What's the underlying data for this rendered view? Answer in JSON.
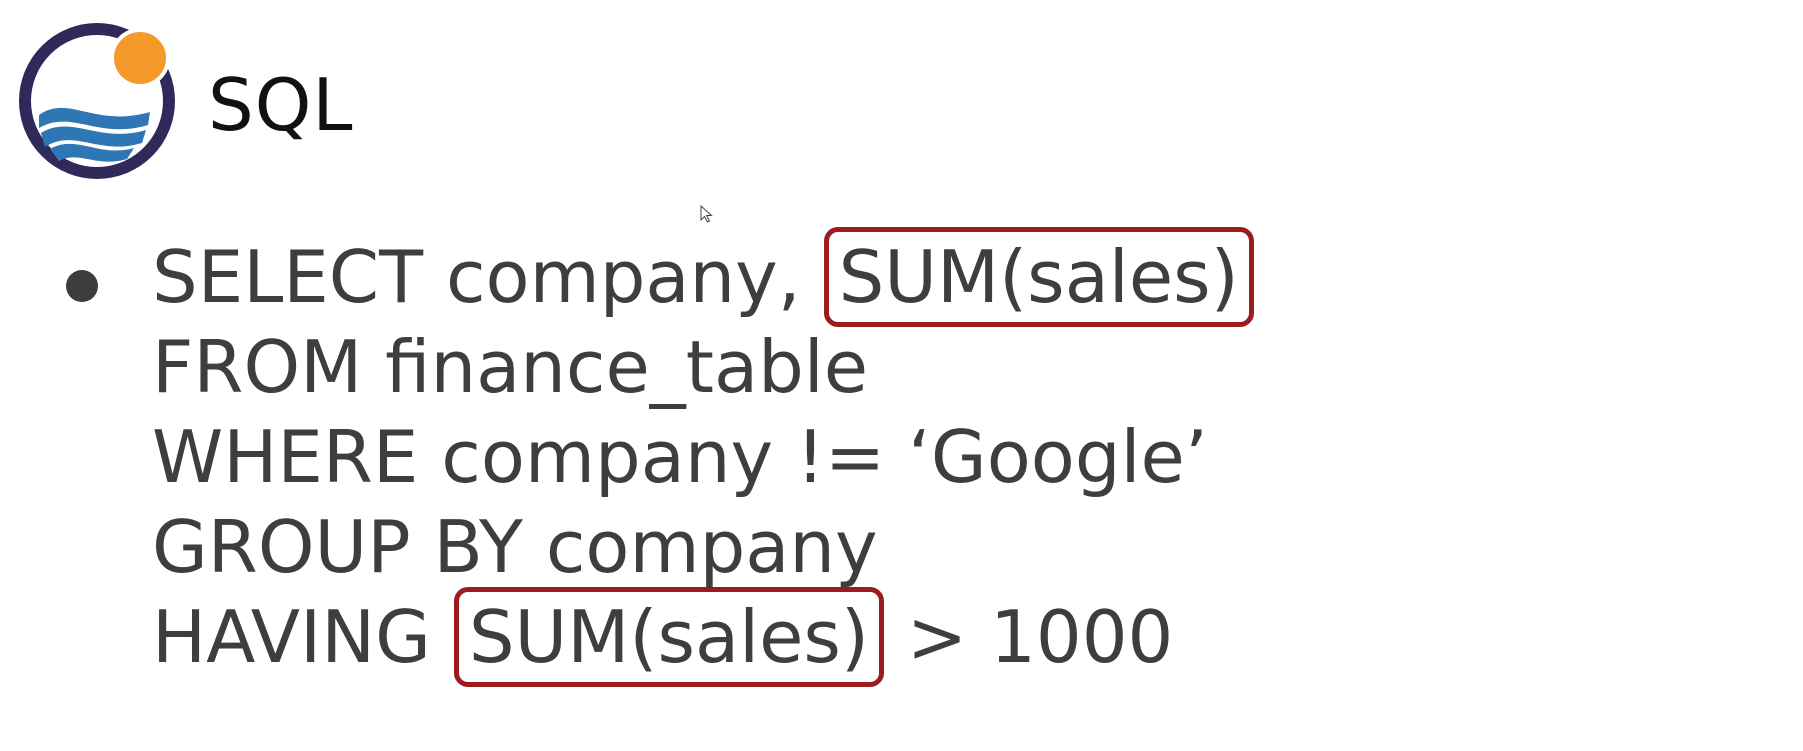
{
  "header": {
    "title": "SQL"
  },
  "code": {
    "lines": [
      {
        "before": "SELECT company, ",
        "highlight": "SUM(sales)",
        "after": ""
      },
      {
        "before": "FROM finance_table",
        "highlight": "",
        "after": ""
      },
      {
        "before": "WHERE company != ‘Google’",
        "highlight": "",
        "after": ""
      },
      {
        "before": "GROUP BY company",
        "highlight": "",
        "after": ""
      },
      {
        "before": "HAVING ",
        "highlight": "SUM(sales)",
        "after": " > 1000"
      }
    ]
  },
  "icons": {
    "logo": "logo-icon",
    "bullet": "bullet-icon",
    "cursor": "mouse-cursor-icon"
  },
  "colors": {
    "highlight_border": "#9b1c1f",
    "code_text": "#3e3e3e",
    "logo_ring": "#2f2a5a",
    "logo_sun": "#f39a2b",
    "logo_wave": "#2f76b5"
  }
}
